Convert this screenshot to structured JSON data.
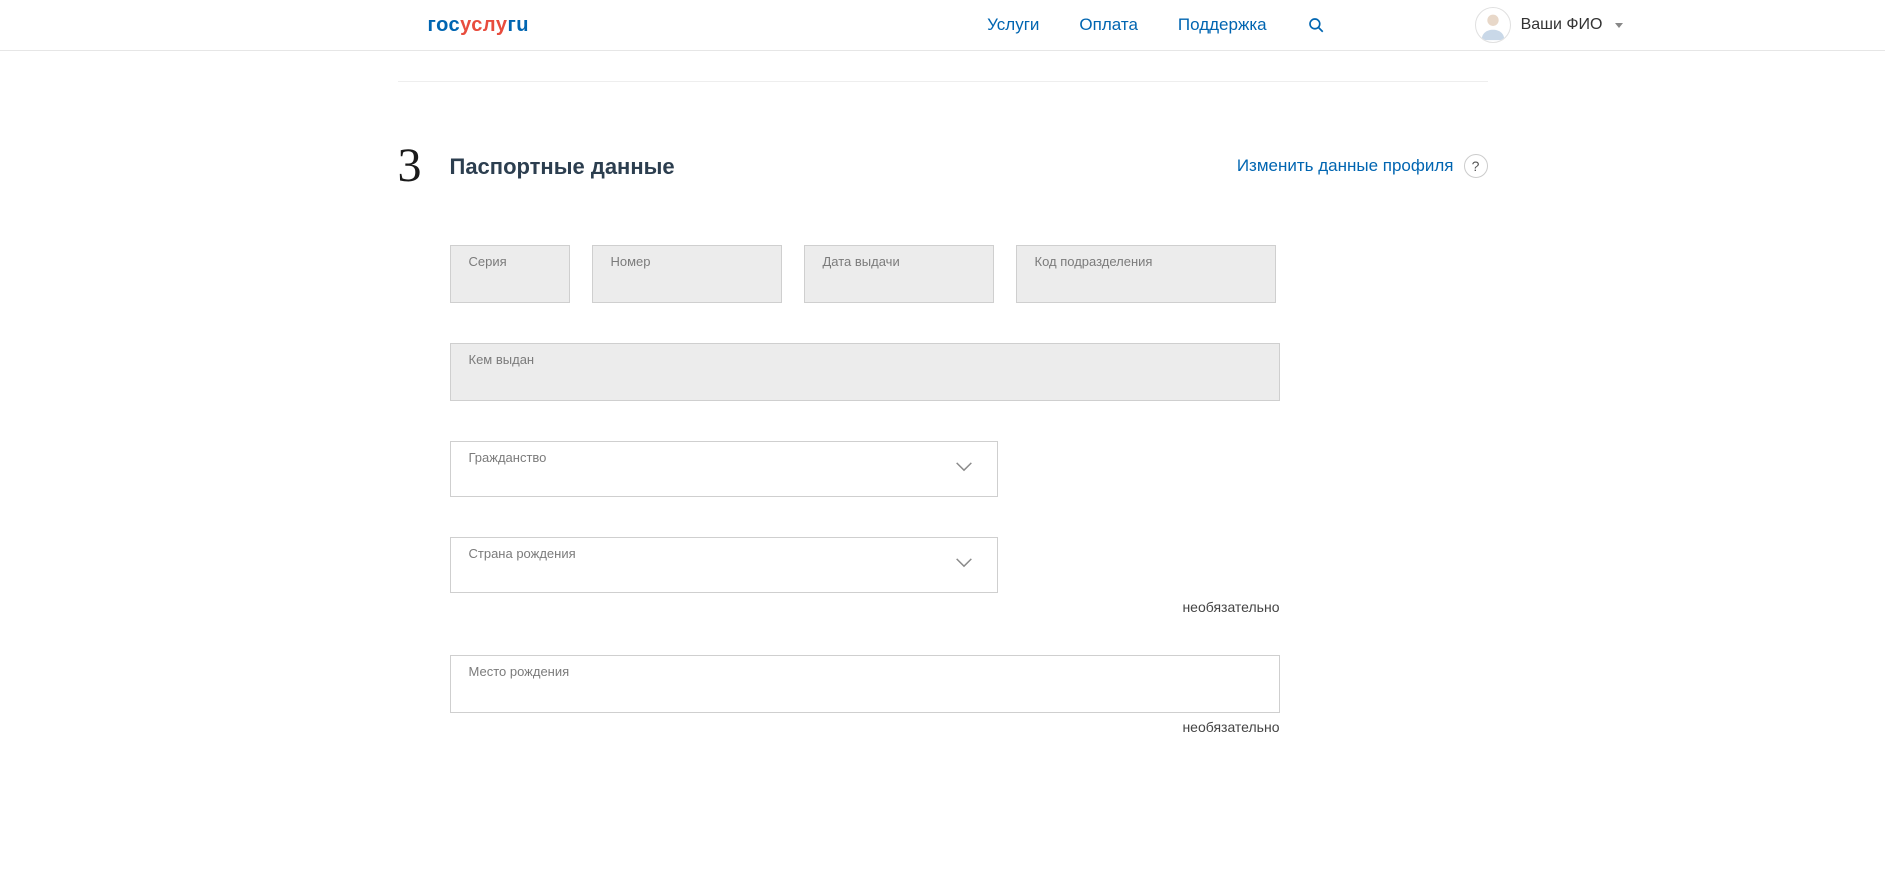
{
  "header": {
    "logo_gos": "гос",
    "logo_usl": "услу",
    "logo_gi": "гu",
    "nav": {
      "services": "Услуги",
      "payment": "Оплата",
      "support": "Поддержка"
    },
    "user_name": "Ваши ФИО"
  },
  "section": {
    "step": "3",
    "title": "Паспортные данные",
    "edit_profile": "Изменить данные профиля",
    "help": "?"
  },
  "fields": {
    "series_label": "Серия",
    "series_value": "",
    "number_label": "Номер",
    "number_value": "",
    "issue_date_label": "Дата выдачи",
    "issue_date_value": "",
    "dept_code_label": "Код подразделения",
    "dept_code_value": "",
    "issued_by_label": "Кем выдан",
    "issued_by_value": "",
    "citizenship_label": "Гражданство",
    "citizenship_value": "",
    "birth_country_label": "Страна рождения",
    "birth_country_value": "",
    "birth_place_label": "Место рождения",
    "birth_place_value": "",
    "optional_hint": "необязательно"
  }
}
